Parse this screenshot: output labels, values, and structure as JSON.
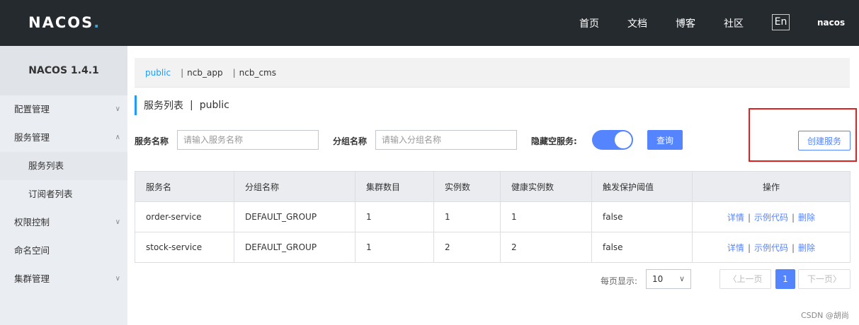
{
  "header": {
    "logo_text": "NACOS",
    "logo_dot": ".",
    "nav": [
      "首页",
      "文档",
      "博客",
      "社区"
    ],
    "lang": "En",
    "username": "nacos"
  },
  "sidebar": {
    "title": "NACOS 1.4.1",
    "items": [
      {
        "label": "配置管理",
        "chevron": "chevron-down"
      },
      {
        "label": "服务管理",
        "chevron": "chevron-up"
      },
      {
        "label": "服务列表"
      },
      {
        "label": "订阅者列表"
      },
      {
        "label": "权限控制",
        "chevron": "chevron-down"
      },
      {
        "label": "命名空间"
      },
      {
        "label": "集群管理",
        "chevron": "chevron-down"
      }
    ]
  },
  "namespaces": [
    "public",
    "ncb_app",
    "ncb_cms"
  ],
  "ns_sep": "|",
  "page_heading": {
    "title": "服务列表",
    "sep": "|",
    "namespace": "public"
  },
  "search": {
    "service_label": "服务名称",
    "service_placeholder": "请输入服务名称",
    "group_label": "分组名称",
    "group_placeholder": "请输入分组名称",
    "hide_empty_label": "隐藏空服务:",
    "query_button": "查询",
    "create_button": "创建服务"
  },
  "table": {
    "headers": [
      "服务名",
      "分组名称",
      "集群数目",
      "实例数",
      "健康实例数",
      "触发保护阈值",
      "操作"
    ],
    "rows": [
      [
        "order-service",
        "DEFAULT_GROUP",
        "1",
        "1",
        "1",
        "false"
      ],
      [
        "stock-service",
        "DEFAULT_GROUP",
        "1",
        "2",
        "2",
        "false"
      ]
    ],
    "ops": [
      "详情",
      "示例代码",
      "删除"
    ],
    "op_sep": "|"
  },
  "pagination": {
    "page_size_label": "每页显示:",
    "page_size": "10",
    "prev": "上一页",
    "current": "1",
    "next": "下一页"
  },
  "watermark": "CSDN @胡尚",
  "colors": {
    "accent": "#5584ff",
    "header_bg": "#252a2f",
    "highlight": "#e02020"
  }
}
